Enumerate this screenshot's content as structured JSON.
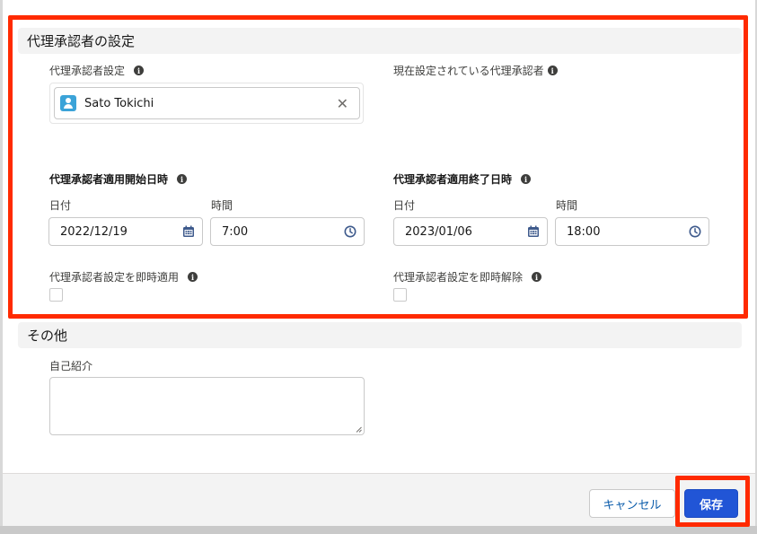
{
  "delegate_section": {
    "title": "代理承認者の設定",
    "delegate_setting_label": "代理承認者設定",
    "current_delegate_label": "現在設定されている代理承認者",
    "selected_user": "Sato Tokichi",
    "remove_glyph": "✕",
    "start_label": "代理承認者適用開始日時",
    "end_label": "代理承認者適用終了日時",
    "start_date_label": "日付",
    "start_time_label": "時間",
    "start_date_value": "2022/12/19",
    "start_time_value": "7:00",
    "end_date_label": "日付",
    "end_time_label": "時間",
    "end_date_value": "2023/01/06",
    "end_time_value": "18:00",
    "apply_now_label": "代理承認者設定を即時適用",
    "release_now_label": "代理承認者設定を即時解除",
    "apply_now_checked": false,
    "release_now_checked": false
  },
  "other_section": {
    "title": "その他",
    "bio_label": "自己紹介",
    "bio_value": ""
  },
  "footer": {
    "cancel_label": "キャンセル",
    "save_label": "保存"
  },
  "info_glyph": "i",
  "colors": {
    "highlight": "#ff2a00",
    "primary_button": "#2155d6",
    "avatar": "#3ba3d8",
    "section_header_bg": "#f3f3f3"
  }
}
